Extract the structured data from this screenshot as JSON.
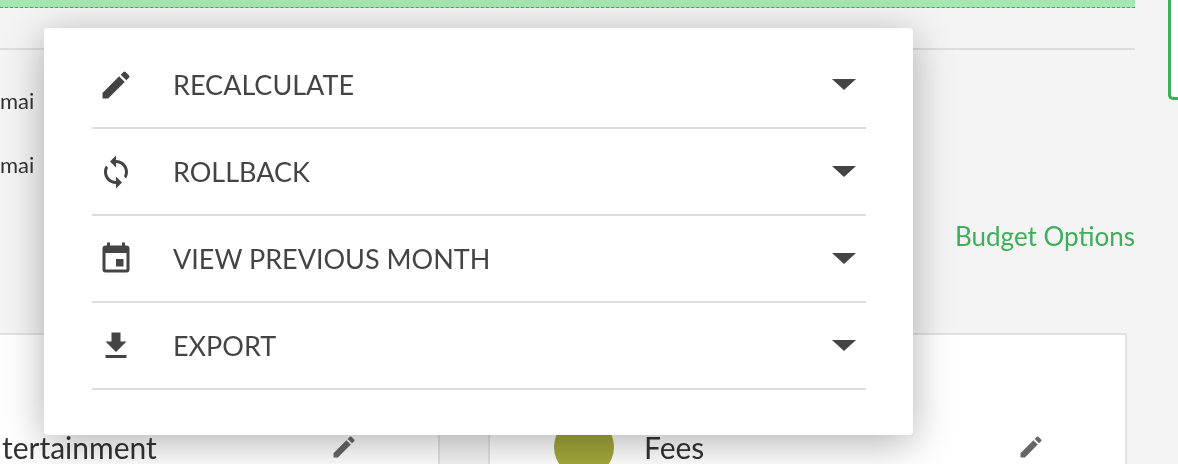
{
  "background": {
    "lines": [
      "mai",
      "mai"
    ],
    "budget_link": "Budget Options",
    "cards": [
      {
        "title": "tertainment"
      },
      {
        "title": "Fees",
        "color": "#a3a83a"
      }
    ]
  },
  "menu": {
    "items": [
      {
        "kind": "edit",
        "label": "RECALCULATE"
      },
      {
        "kind": "sync",
        "label": "ROLLBACK"
      },
      {
        "kind": "calendar",
        "label": "VIEW PREVIOUS MONTH"
      },
      {
        "kind": "download",
        "label": "EXPORT"
      }
    ]
  }
}
